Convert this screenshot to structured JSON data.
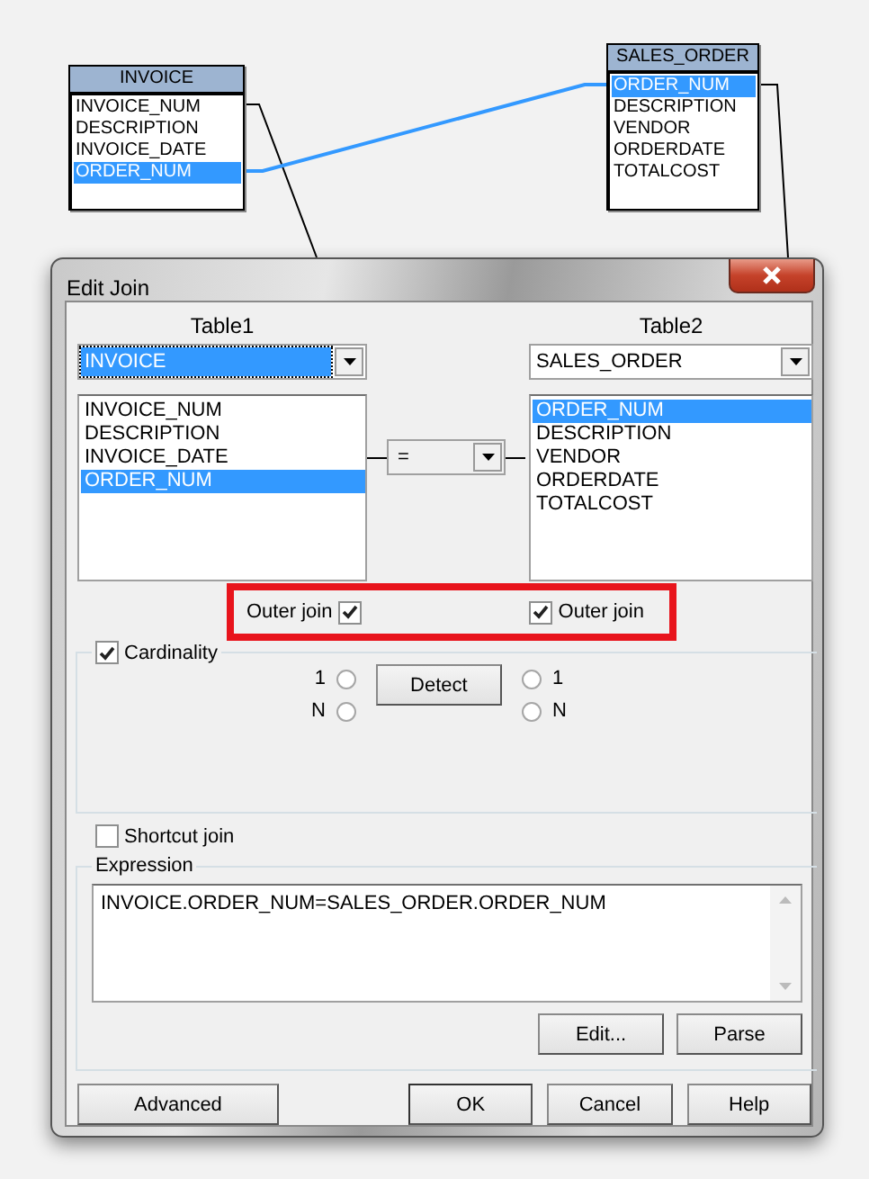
{
  "diagram": {
    "tables": [
      {
        "name": "INVOICE",
        "columns": [
          {
            "name": "INVOICE_NUM",
            "selected": false
          },
          {
            "name": "DESCRIPTION",
            "selected": false
          },
          {
            "name": "INVOICE_DATE",
            "selected": false
          },
          {
            "name": "ORDER_NUM",
            "selected": true
          }
        ]
      },
      {
        "name": "SALES_ORDER",
        "columns": [
          {
            "name": "ORDER_NUM",
            "selected": true
          },
          {
            "name": "DESCRIPTION",
            "selected": false
          },
          {
            "name": "VENDOR",
            "selected": false
          },
          {
            "name": "ORDERDATE",
            "selected": false
          },
          {
            "name": "TOTALCOST",
            "selected": false
          }
        ]
      }
    ]
  },
  "dialog": {
    "title": "Edit Join",
    "tables": [
      {
        "label": "Table1",
        "value": "INVOICE",
        "focused": true,
        "columns": [
          {
            "name": "INVOICE_NUM",
            "selected": false
          },
          {
            "name": "DESCRIPTION",
            "selected": false
          },
          {
            "name": "INVOICE_DATE",
            "selected": false
          },
          {
            "name": "ORDER_NUM",
            "selected": true
          }
        ]
      },
      {
        "label": "Table2",
        "value": "SALES_ORDER",
        "focused": false,
        "columns": [
          {
            "name": "ORDER_NUM",
            "selected": true
          },
          {
            "name": "DESCRIPTION",
            "selected": false
          },
          {
            "name": "VENDOR",
            "selected": false
          },
          {
            "name": "ORDERDATE",
            "selected": false
          },
          {
            "name": "TOTALCOST",
            "selected": false
          }
        ]
      }
    ],
    "operator": "=",
    "outer_join": {
      "highlighted": true,
      "options": [
        {
          "label": "Outer join",
          "checked": true
        },
        {
          "label": "Outer join",
          "checked": true
        }
      ]
    },
    "cardinality": {
      "label": "Cardinality",
      "checked": true,
      "left": [
        {
          "label": "1",
          "selected": false
        },
        {
          "label": "N",
          "selected": false
        }
      ],
      "detect_button": "Detect",
      "right": [
        {
          "label": "1",
          "selected": false
        },
        {
          "label": "N",
          "selected": false
        }
      ]
    },
    "shortcut_join": {
      "label": "Shortcut join",
      "checked": false
    },
    "expression": {
      "label": "Expression",
      "value": "INVOICE.ORDER_NUM=SALES_ORDER.ORDER_NUM",
      "buttons": [
        "Edit...",
        "Parse"
      ]
    },
    "buttons": [
      {
        "label": "Advanced",
        "default": false
      },
      {
        "label": "OK",
        "default": true
      },
      {
        "label": "Cancel",
        "default": false
      },
      {
        "label": "Help",
        "default": false
      }
    ]
  }
}
